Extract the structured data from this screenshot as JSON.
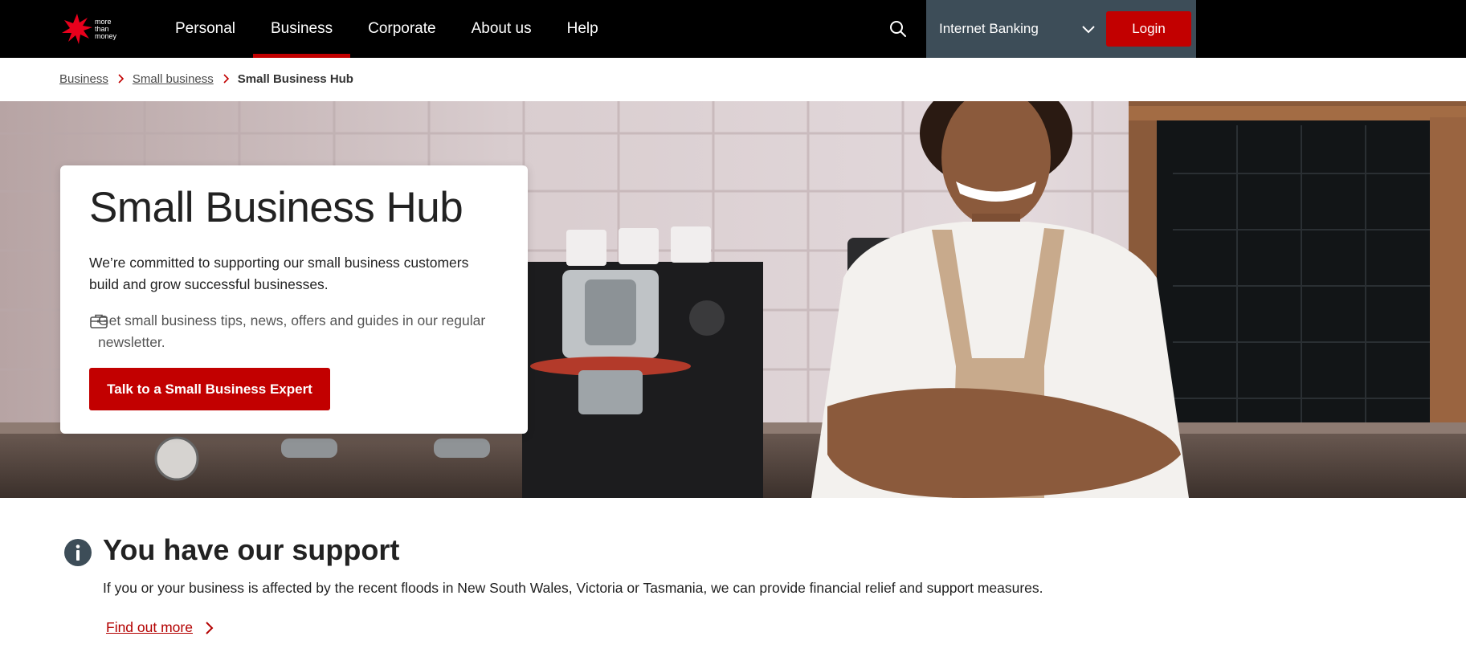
{
  "brand": {
    "tagline_lines": [
      "more",
      "than",
      "money"
    ],
    "accent_color": "#c20000"
  },
  "nav": {
    "items": [
      {
        "label": "Personal",
        "active": false
      },
      {
        "label": "Business",
        "active": true
      },
      {
        "label": "Corporate",
        "active": false
      },
      {
        "label": "About us",
        "active": false
      },
      {
        "label": "Help",
        "active": false
      }
    ],
    "search_icon": "search-icon",
    "internet_banking_label": "Internet Banking",
    "login_label": "Login"
  },
  "breadcrumb": {
    "items": [
      "Business",
      "Small business"
    ],
    "current": "Small Business Hub"
  },
  "hero": {
    "title": "Small Business Hub",
    "description": "We’re committed to supporting our small business customers build and grow successful businesses.",
    "newsletter_icon": "briefcase-icon",
    "newsletter_text": "Get small business tips, news, offers and guides in our regular newsletter.",
    "cta_label": "Talk to a Small Business Expert"
  },
  "support": {
    "icon": "info-icon",
    "title": "You have our support",
    "text": "If you or your business is affected by the recent floods in New South Wales, Victoria or Tasmania, we can provide financial relief and support measures.",
    "link_label": "Find out more"
  }
}
